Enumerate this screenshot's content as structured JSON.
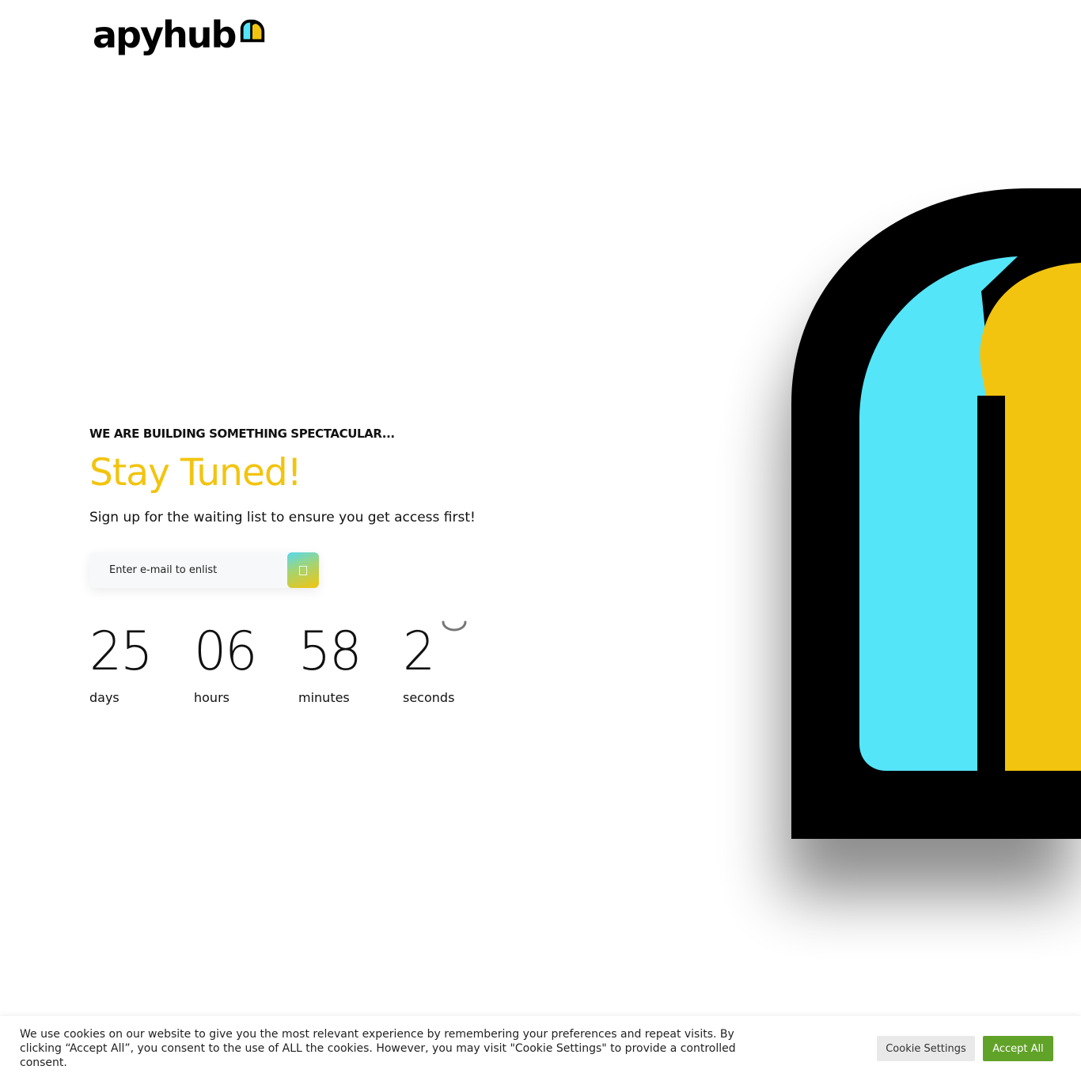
{
  "brand": {
    "name": "apyhub",
    "colors": {
      "cyan": "#55E5F9",
      "yellow": "#F2C40F",
      "black": "#000000"
    },
    "logo_icon": "apyhub-logo-mark-icon"
  },
  "hero": {
    "eyebrow": "WE ARE BUILDING SOMETHING SPECTACULAR...",
    "headline": "Stay Tuned!",
    "subtext": "Sign up for the waiting list to ensure you get access first!",
    "headline_color": "#F2C40F"
  },
  "signup": {
    "placeholder": "Enter e-mail to enlist",
    "value": "",
    "button_icon": "send-icon"
  },
  "countdown": {
    "days": {
      "value": "25",
      "label": "days"
    },
    "hours": {
      "value": "06",
      "label": "hours"
    },
    "minutes": {
      "value": "58",
      "label": "minutes"
    },
    "seconds": {
      "value": "2",
      "label": "seconds"
    }
  },
  "cookie_bar": {
    "text": "We use cookies on our website to give you the most relevant experience by remembering your preferences and repeat visits. By clicking “Accept All”, you consent to the use of ALL the cookies. However, you may visit \"Cookie Settings\" to provide a controlled consent.",
    "settings_label": "Cookie Settings",
    "accept_label": "Accept All",
    "accept_color": "#61A229"
  }
}
